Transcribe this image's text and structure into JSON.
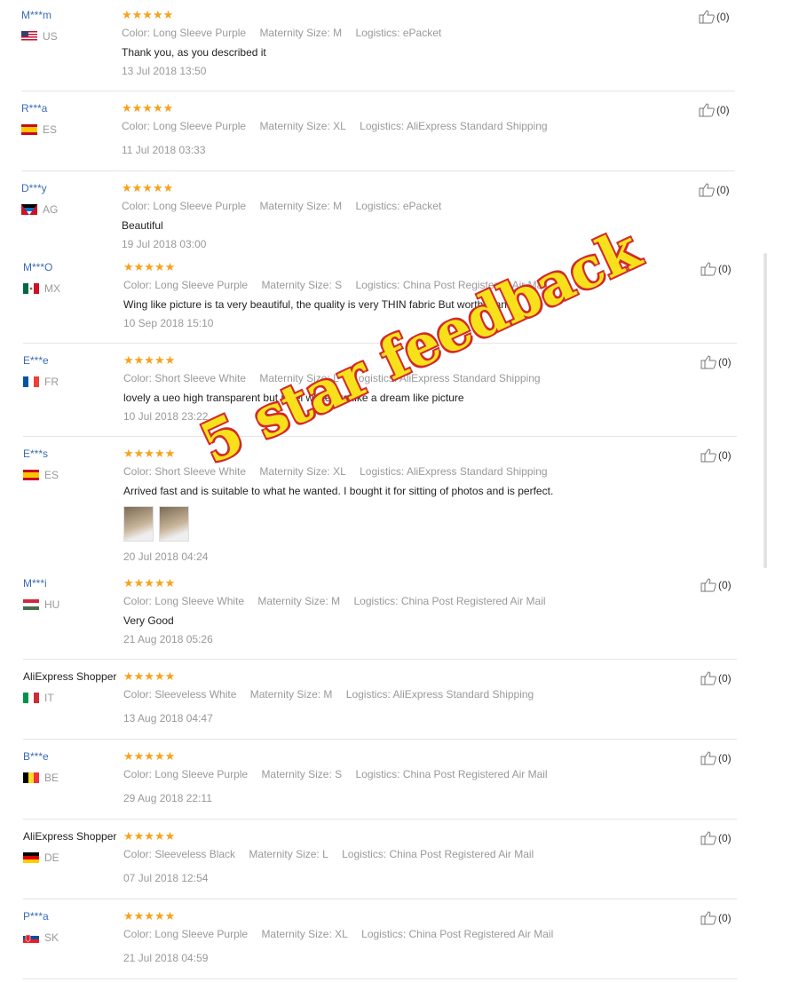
{
  "watermark": "5 star feedback",
  "reviews": [
    {
      "user": "M***m",
      "country": "US",
      "flag": "us",
      "stars": "★★★★★",
      "color": "Color: Long Sleeve Purple",
      "size": "Maternity Size: M",
      "logistics": "Logistics: ePacket",
      "text": "Thank you, as you described it",
      "date": "13 Jul 2018 13:50",
      "useful": "(0)"
    },
    {
      "user": "R***a",
      "country": "ES",
      "flag": "es",
      "stars": "★★★★★",
      "color": "Color: Long Sleeve Purple",
      "size": "Maternity Size: XL",
      "logistics": "Logistics: AliExpress Standard Shipping",
      "text": "",
      "date": "11 Jul 2018 03:33",
      "useful": "(0)"
    },
    {
      "user": "D***y",
      "country": "AG",
      "flag": "ag",
      "stars": "★★★★★",
      "color": "Color: Long Sleeve Purple",
      "size": "Maternity Size: M",
      "logistics": "Logistics: ePacket",
      "text": "Beautiful",
      "date": "19 Jul 2018 03:00",
      "useful": "(0)"
    },
    {
      "user": "M***O",
      "country": "MX",
      "flag": "mx",
      "stars": "★★★★★",
      "color": "Color: Long Sleeve Purple",
      "size": "Maternity Size: S",
      "logistics": "Logistics: China Post Registered Air Mail",
      "text": "Wing like picture is ta very beautiful, the quality is very THIN fabric But worth thanks",
      "date": "10 Sep 2018 15:10",
      "useful": "(0)"
    },
    {
      "user": "E***e",
      "country": "FR",
      "flag": "fr",
      "stars": "★★★★★",
      "color": "Color: Short Sleeve White",
      "size": "Maternity Size: L",
      "logistics": "Logistics: AliExpress Standard Shipping",
      "text": "lovely a ueo high transparent but nikel white bra like a dream like picture",
      "date": "10 Jul 2018 23:22",
      "useful": "(0)"
    },
    {
      "user": "E***s",
      "country": "ES",
      "flag": "es",
      "stars": "★★★★★",
      "color": "Color: Short Sleeve White",
      "size": "Maternity Size: XL",
      "logistics": "Logistics: AliExpress Standard Shipping",
      "text": "Arrived fast and is suitable to what he wanted. I bought it for sitting of photos and is perfect.",
      "date": "20 Jul 2018 04:24",
      "useful": "(0)"
    },
    {
      "user": "M***i",
      "country": "HU",
      "flag": "hu",
      "stars": "★★★★★",
      "color": "Color: Long Sleeve White",
      "size": "Maternity Size: M",
      "logistics": "Logistics: China Post Registered Air Mail",
      "text": "Very Good",
      "date": "21 Aug 2018 05:26",
      "useful": "(0)"
    },
    {
      "user": "AliExpress Shopper",
      "country": "IT",
      "flag": "it",
      "stars": "★★★★★",
      "color": "Color: Sleeveless White",
      "size": "Maternity Size: M",
      "logistics": "Logistics: AliExpress Standard Shipping",
      "text": "",
      "date": "13 Aug 2018 04:47",
      "useful": "(0)"
    },
    {
      "user": "B***e",
      "country": "BE",
      "flag": "be",
      "stars": "★★★★★",
      "color": "Color: Long Sleeve Purple",
      "size": "Maternity Size: S",
      "logistics": "Logistics: China Post Registered Air Mail",
      "text": "",
      "date": "29 Aug 2018 22:11",
      "useful": "(0)"
    },
    {
      "user": "AliExpress Shopper",
      "country": "DE",
      "flag": "de",
      "stars": "★★★★★",
      "color": "Color: Sleeveless Black",
      "size": "Maternity Size: L",
      "logistics": "Logistics: China Post Registered Air Mail",
      "text": "",
      "date": "07 Jul 2018 12:54",
      "useful": "(0)"
    },
    {
      "user": "P***a",
      "country": "SK",
      "flag": "sk",
      "stars": "★★★★★",
      "color": "Color: Long Sleeve Purple",
      "size": "Maternity Size: XL",
      "logistics": "Logistics: China Post Registered Air Mail",
      "text": "",
      "date": "21 Jul 2018 04:59",
      "useful": "(0)"
    }
  ]
}
